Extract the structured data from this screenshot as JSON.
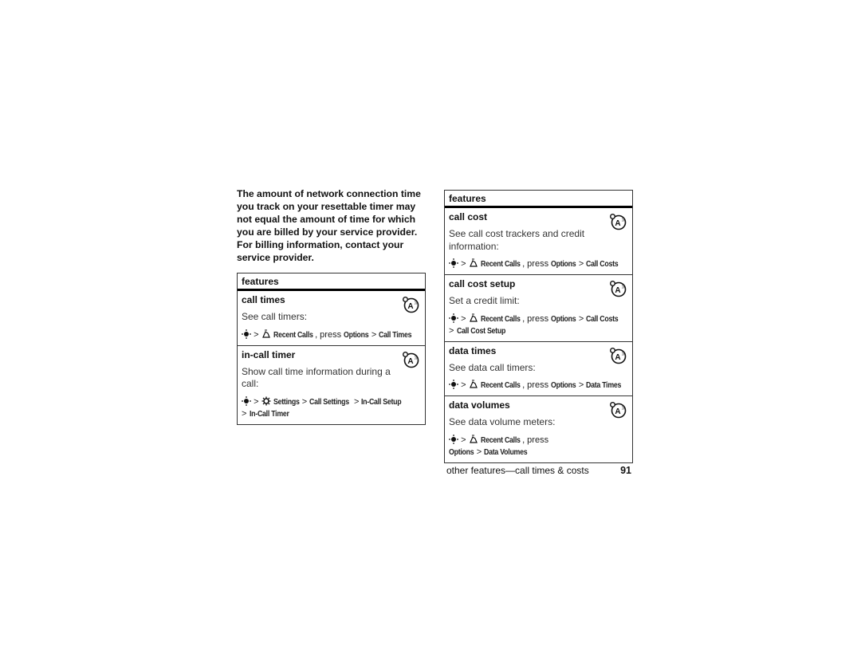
{
  "intro_text": "The amount of network connection time you track on your resettable timer may not equal the amount of time for which you are billed by your service provider. For billing information, contact your service provider.",
  "left_table": {
    "header": "features",
    "rows": [
      {
        "title": "call times",
        "desc": "See call timers:",
        "icon": "network-dependent-feature-icon",
        "path": {
          "nav_icon": "nav-key-icon",
          "sep1": ">",
          "menu_icon": "recent-calls-icon",
          "menu": "Recent Calls",
          "press": ", press",
          "opt": "Options",
          "sep2": ">",
          "item": "Call Times"
        }
      },
      {
        "title": "in-call timer",
        "desc": "Show call time information during a call:",
        "icon": "network-dependent-feature-icon",
        "path": {
          "nav_icon": "nav-key-icon",
          "sep1": ">",
          "menu_icon": "settings-icon",
          "menu": "Settings",
          "sep2": ">",
          "item1": "Call Settings",
          "sep3": ">",
          "item2": "In-Call Setup",
          "sep4": ">",
          "item3": "In-Call Timer"
        }
      }
    ]
  },
  "right_table": {
    "header": "features",
    "rows": [
      {
        "title": "call cost",
        "desc": "See call cost trackers and credit information:",
        "path": {
          "sep1": ">",
          "menu": "Recent Calls",
          "press": ", press",
          "opt": "Options",
          "sep2": ">",
          "item": "Call Costs"
        }
      },
      {
        "title": "call cost setup",
        "desc": "Set a credit limit:",
        "path": {
          "sep1": ">",
          "menu": "Recent Calls",
          "press": ", press",
          "opt": "Options",
          "sep2": ">",
          "item": "Call Costs",
          "sep3": ">",
          "item2": "Call Cost Setup"
        }
      },
      {
        "title": "data times",
        "desc": "See data call timers:",
        "path": {
          "sep1": ">",
          "menu": "Recent Calls",
          "press": ", press",
          "opt": "Options",
          "sep2": ">",
          "item": "Data Times"
        }
      },
      {
        "title": "data volumes",
        "desc": "See data volume meters:",
        "path": {
          "sep1": ">",
          "menu": "Recent Calls",
          "press": ", press",
          "opt": "Options",
          "sep2": ">",
          "item": "Data Volumes"
        }
      }
    ]
  },
  "footer": {
    "section": "other features—call times & costs",
    "page_number": "91"
  }
}
